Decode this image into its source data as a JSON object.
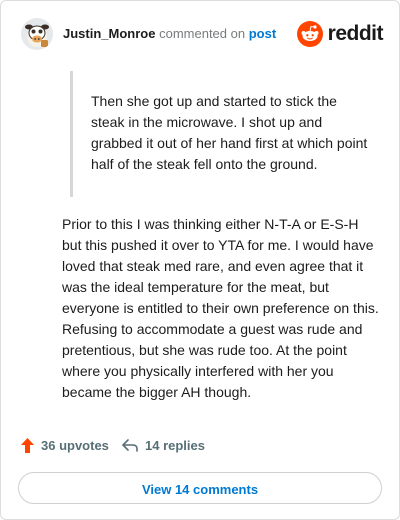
{
  "comment": {
    "username": "Justin_Monroe",
    "action_text": "commented on",
    "post_link": "post",
    "quote": "Then she got up and started to stick the steak in the microwave. I shot up and grabbed it out of her hand first at which point half of the steak fell onto the ground.",
    "body": "Prior to this I was thinking either N-T-A or E-S-H but this pushed it over to YTA for me. I would have loved that steak med rare, and even agree that it was the ideal temperature for the meat, but everyone is entitled to their own preference on this. Refusing to accommodate a guest was rude and pretentious, but she was rude too. At the point where you physically interfered with her you became the bigger AH though."
  },
  "brand": {
    "name": "reddit",
    "accent": "#ff4500"
  },
  "stats": {
    "upvotes_label": "36 upvotes",
    "replies_label": "14 replies"
  },
  "footer": {
    "view_comments_label": "View 14 comments"
  },
  "icons": {
    "avatar": "cartoon-cow-avatar",
    "logo": "reddit-alien-icon",
    "upvote": "upvote-arrow-icon",
    "reply": "reply-arrow-icon"
  },
  "colors": {
    "link_blue": "#0079d3",
    "upvote_orange": "#ff4500",
    "muted_gray": "#576f76"
  }
}
